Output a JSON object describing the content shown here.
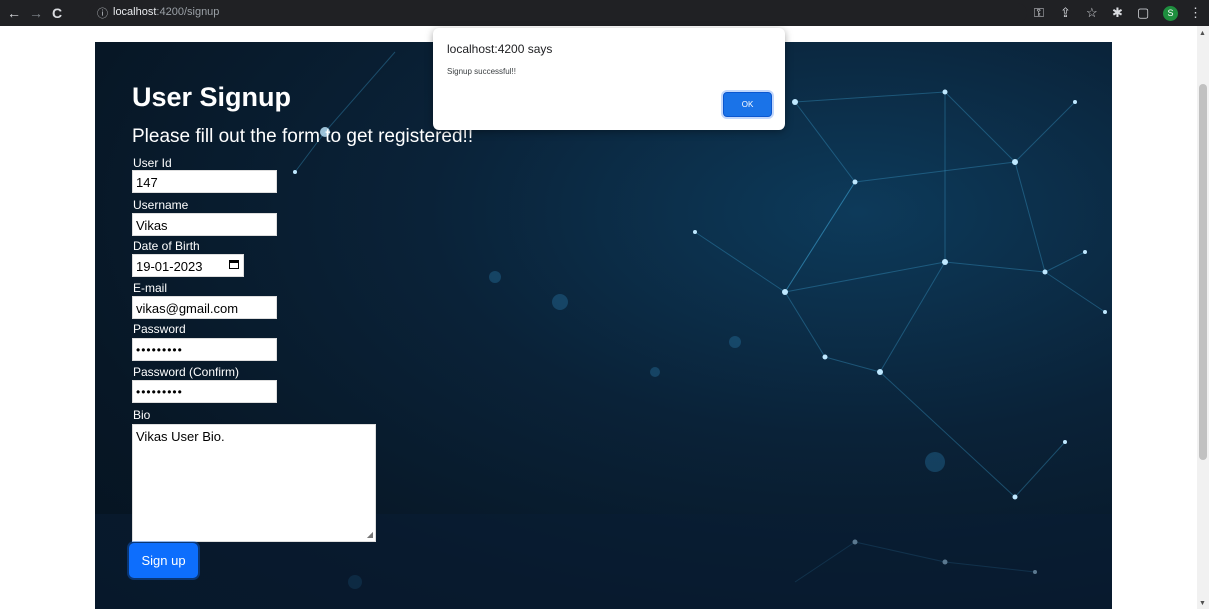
{
  "browser": {
    "url_host": "localhost",
    "url_rest": ":4200/signup",
    "avatar_letter": "S"
  },
  "form": {
    "title": "User Signup",
    "subtitle": "Please fill out the form to get registered!!",
    "fields": {
      "user_id": {
        "label": "User Id",
        "value": "147"
      },
      "username": {
        "label": "Username",
        "value": "Vikas"
      },
      "dob": {
        "label": "Date of Birth",
        "value": "19-01-2023"
      },
      "email": {
        "label": "E-mail",
        "value": "vikas@gmail.com"
      },
      "password": {
        "label": "Password",
        "value": "•••••••••"
      },
      "password_confirm": {
        "label": "Password (Confirm)",
        "value": "•••••••••"
      },
      "bio": {
        "label": "Bio",
        "value": "Vikas User Bio."
      }
    },
    "submit_label": "Sign up"
  },
  "dialog": {
    "title": "localhost:4200 says",
    "message": "Signup successful!!",
    "ok_label": "OK"
  },
  "colors": {
    "accent": "#0d6efd",
    "dialog_button": "#1a73e8",
    "hero_bg": "#071726",
    "chrome_bar": "#202124"
  }
}
